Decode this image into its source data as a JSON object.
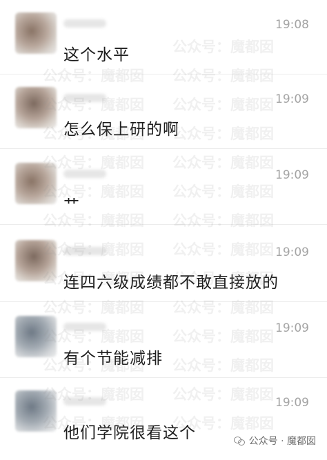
{
  "comments": [
    {
      "time": "19:08",
      "text": "这个水平"
    },
    {
      "time": "19:09",
      "text": "怎么保上研的啊"
    },
    {
      "time": "19:09",
      "text": "艹"
    },
    {
      "time": "19:09",
      "text": "连四六级成绩都不敢直接放的"
    },
    {
      "time": "19:09",
      "text": "有个节能减排"
    },
    {
      "time": "19:09",
      "text": "他们学院很看这个"
    }
  ],
  "watermark": {
    "text": "公众号：魔都囡",
    "footer": "公众号 · 魔都囡"
  }
}
